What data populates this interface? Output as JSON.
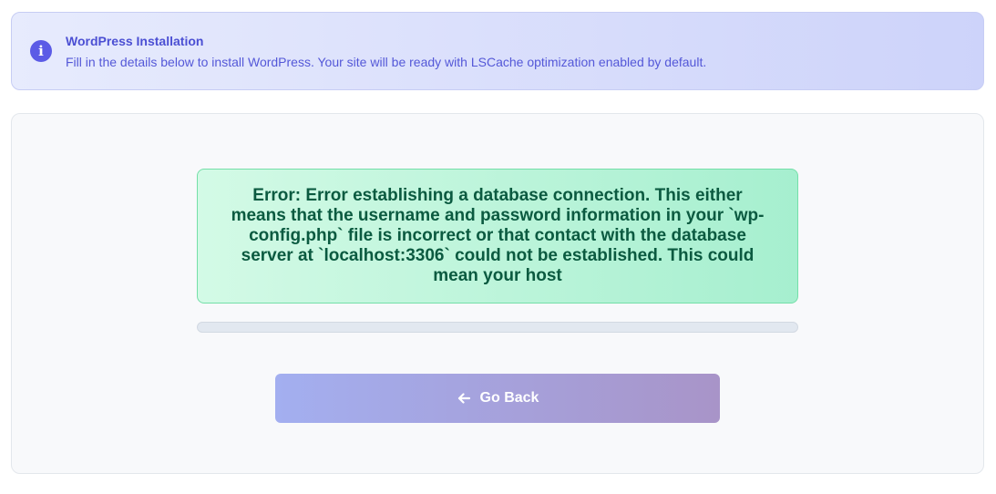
{
  "banner": {
    "icon": "info-icon",
    "icon_glyph": "i",
    "title": "WordPress Installation",
    "text": "Fill in the details below to install WordPress. Your site will be ready with LSCache optimization enabled by default."
  },
  "status": {
    "message": "Error: Error establishing a database connection. This either means that the username and password information in your `wp-config.php` file is incorrect or that contact with the database server at `localhost:3306` could not be established. This could mean your host"
  },
  "progress": {
    "value": 0
  },
  "actions": {
    "back_icon": "arrow-left-icon",
    "back_label": "Go Back"
  },
  "colors": {
    "accent": "#5b5be6",
    "status_text": "#0b5a40",
    "status_border": "#74dfa8"
  }
}
